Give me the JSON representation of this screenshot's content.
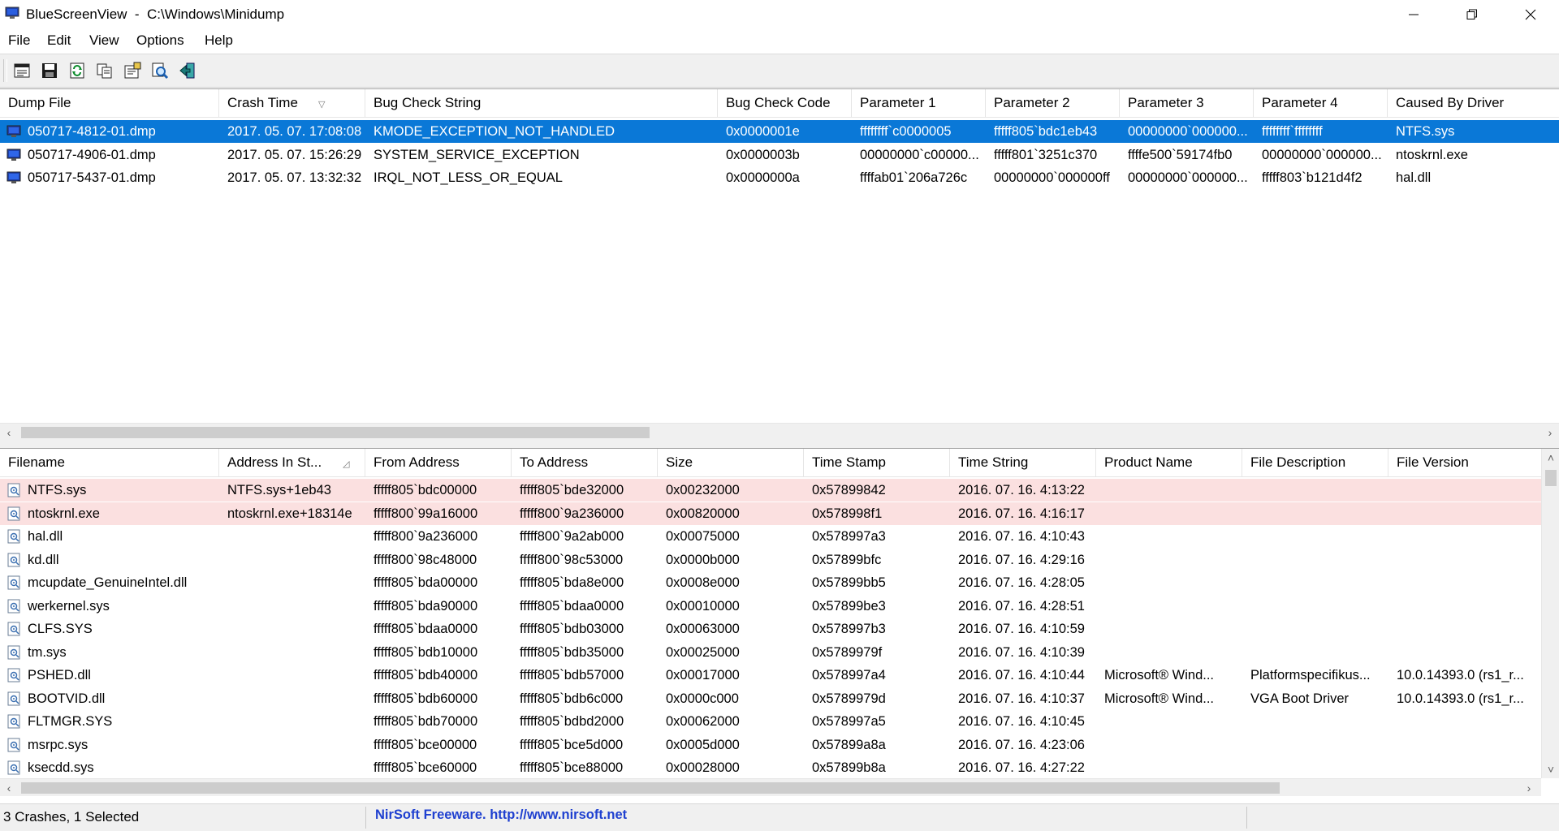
{
  "window": {
    "title": "BlueScreenView  -  C:\\Windows\\Minidump"
  },
  "menu": [
    "File",
    "Edit",
    "View",
    "Options",
    "Help"
  ],
  "toolbar": {
    "buttons": [
      "html-report-icon",
      "save-icon",
      "refresh-icon",
      "copy-icon",
      "properties-icon",
      "find-icon",
      "exit-icon"
    ]
  },
  "crashes": {
    "columns": [
      "Dump File",
      "Crash Time",
      "Bug Check String",
      "Bug Check Code",
      "Parameter 1",
      "Parameter 2",
      "Parameter 3",
      "Parameter 4",
      "Caused By Driver"
    ],
    "sorted_column": "Crash Time",
    "rows": [
      [
        "050717-4812-01.dmp",
        "2017. 05. 07. 17:08:08",
        "KMODE_EXCEPTION_NOT_HANDLED",
        "0x0000001e",
        "ffffffff`c0000005",
        "fffff805`bdc1eb43",
        "00000000`000000...",
        "ffffffff`ffffffff",
        "NTFS.sys"
      ],
      [
        "050717-4906-01.dmp",
        "2017. 05. 07. 15:26:29",
        "SYSTEM_SERVICE_EXCEPTION",
        "0x0000003b",
        "00000000`c00000...",
        "fffff801`3251c370",
        "ffffe500`59174fb0",
        "00000000`000000...",
        "ntoskrnl.exe"
      ],
      [
        "050717-5437-01.dmp",
        "2017. 05. 07. 13:32:32",
        "IRQL_NOT_LESS_OR_EQUAL",
        "0x0000000a",
        "ffffab01`206a726c",
        "00000000`000000ff",
        "00000000`000000...",
        "fffff803`b121d4f2",
        "hal.dll"
      ]
    ],
    "selected_index": 0
  },
  "drivers": {
    "columns": [
      "Filename",
      "Address In St...",
      "From Address",
      "To Address",
      "Size",
      "Time Stamp",
      "Time String",
      "Product Name",
      "File Description",
      "File Version"
    ],
    "sorted_column": "Address In St...",
    "rows": [
      [
        "NTFS.sys",
        "NTFS.sys+1eb43",
        "fffff805`bdc00000",
        "fffff805`bde32000",
        "0x00232000",
        "0x57899842",
        "2016. 07. 16. 4:13:22",
        "",
        "",
        ""
      ],
      [
        "ntoskrnl.exe",
        "ntoskrnl.exe+18314e",
        "fffff800`99a16000",
        "fffff800`9a236000",
        "0x00820000",
        "0x578998f1",
        "2016. 07. 16. 4:16:17",
        "",
        "",
        ""
      ],
      [
        "hal.dll",
        "",
        "fffff800`9a236000",
        "fffff800`9a2ab000",
        "0x00075000",
        "0x578997a3",
        "2016. 07. 16. 4:10:43",
        "",
        "",
        ""
      ],
      [
        "kd.dll",
        "",
        "fffff800`98c48000",
        "fffff800`98c53000",
        "0x0000b000",
        "0x57899bfc",
        "2016. 07. 16. 4:29:16",
        "",
        "",
        ""
      ],
      [
        "mcupdate_GenuineIntel.dll",
        "",
        "fffff805`bda00000",
        "fffff805`bda8e000",
        "0x0008e000",
        "0x57899bb5",
        "2016. 07. 16. 4:28:05",
        "",
        "",
        ""
      ],
      [
        "werkernel.sys",
        "",
        "fffff805`bda90000",
        "fffff805`bdaa0000",
        "0x00010000",
        "0x57899be3",
        "2016. 07. 16. 4:28:51",
        "",
        "",
        ""
      ],
      [
        "CLFS.SYS",
        "",
        "fffff805`bdaa0000",
        "fffff805`bdb03000",
        "0x00063000",
        "0x578997b3",
        "2016. 07. 16. 4:10:59",
        "",
        "",
        ""
      ],
      [
        "tm.sys",
        "",
        "fffff805`bdb10000",
        "fffff805`bdb35000",
        "0x00025000",
        "0x5789979f",
        "2016. 07. 16. 4:10:39",
        "",
        "",
        ""
      ],
      [
        "PSHED.dll",
        "",
        "fffff805`bdb40000",
        "fffff805`bdb57000",
        "0x00017000",
        "0x578997a4",
        "2016. 07. 16. 4:10:44",
        "Microsoft® Wind...",
        "Platformspecifikus...",
        "10.0.14393.0 (rs1_r..."
      ],
      [
        "BOOTVID.dll",
        "",
        "fffff805`bdb60000",
        "fffff805`bdb6c000",
        "0x0000c000",
        "0x5789979d",
        "2016. 07. 16. 4:10:37",
        "Microsoft® Wind...",
        "VGA Boot Driver",
        "10.0.14393.0 (rs1_r..."
      ],
      [
        "FLTMGR.SYS",
        "",
        "fffff805`bdb70000",
        "fffff805`bdbd2000",
        "0x00062000",
        "0x578997a5",
        "2016. 07. 16. 4:10:45",
        "",
        "",
        ""
      ],
      [
        "msrpc.sys",
        "",
        "fffff805`bce00000",
        "fffff805`bce5d000",
        "0x0005d000",
        "0x57899a8a",
        "2016. 07. 16. 4:23:06",
        "",
        "",
        ""
      ],
      [
        "ksecdd.sys",
        "",
        "fffff805`bce60000",
        "fffff805`bce88000",
        "0x00028000",
        "0x57899b8a",
        "2016. 07. 16. 4:27:22",
        "",
        "",
        ""
      ]
    ],
    "highlighted_count": 2
  },
  "status": {
    "summary": "3 Crashes, 1 Selected",
    "link": "NirSoft Freeware.  http://www.nirsoft.net"
  },
  "colors": {
    "selection": "#0a78d7",
    "highlight_row": "#fbe0e0",
    "link": "#1f40d0"
  }
}
